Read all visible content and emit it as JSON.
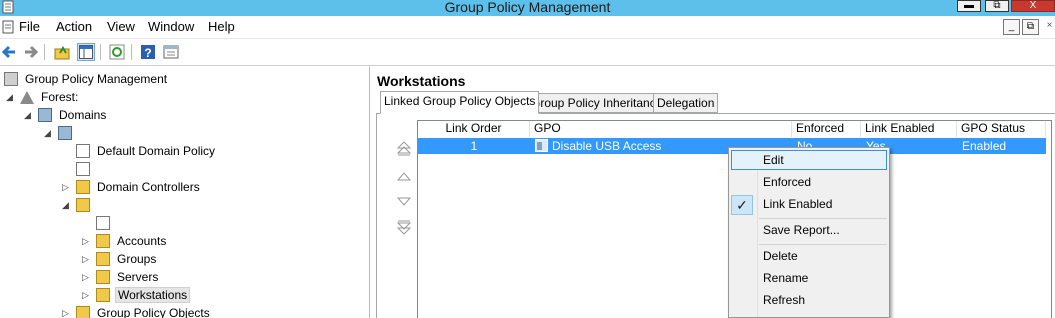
{
  "window": {
    "title": "Group Policy Management",
    "min_label": "▬",
    "max_label": "⧉",
    "close_label": "X"
  },
  "menu": {
    "items": [
      "File",
      "Action",
      "View",
      "Window",
      "Help"
    ],
    "mdi_min": "_",
    "mdi_restore": "⧉",
    "mdi_close": "×"
  },
  "tree": {
    "root": "Group Policy Management",
    "forest": "Forest:",
    "domains": "Domains",
    "domain_name": "",
    "default_policy": "Default Domain Policy",
    "unnamed_gpo": "",
    "domain_controllers": "Domain Controllers",
    "ou_name": "",
    "firewall_policy": "",
    "accounts": "Accounts",
    "groups": "Groups",
    "servers": "Servers",
    "workstations": "Workstations",
    "gpo_container": "Group Policy Objects"
  },
  "right": {
    "title": "Workstations",
    "tabs": [
      "Linked Group Policy Objects",
      "Group Policy Inheritance",
      "Delegation"
    ],
    "columns": [
      "Link Order",
      "GPO",
      "Enforced",
      "Link Enabled",
      "GPO Status"
    ],
    "rows": [
      {
        "link_order": "1",
        "gpo": "Disable USB Access",
        "enforced": "No",
        "link_enabled": "Yes",
        "gpo_status": "Enabled"
      }
    ]
  },
  "context_menu": {
    "items": [
      "Edit",
      "Enforced",
      "Link Enabled",
      "Save Report...",
      "Delete",
      "Rename",
      "Refresh"
    ],
    "checked": "Link Enabled",
    "check_glyph": "✓"
  },
  "colors": {
    "titlebar": "#5dc0ea",
    "selection": "#3399ff",
    "menu_highlight": "#e5f1fb"
  }
}
